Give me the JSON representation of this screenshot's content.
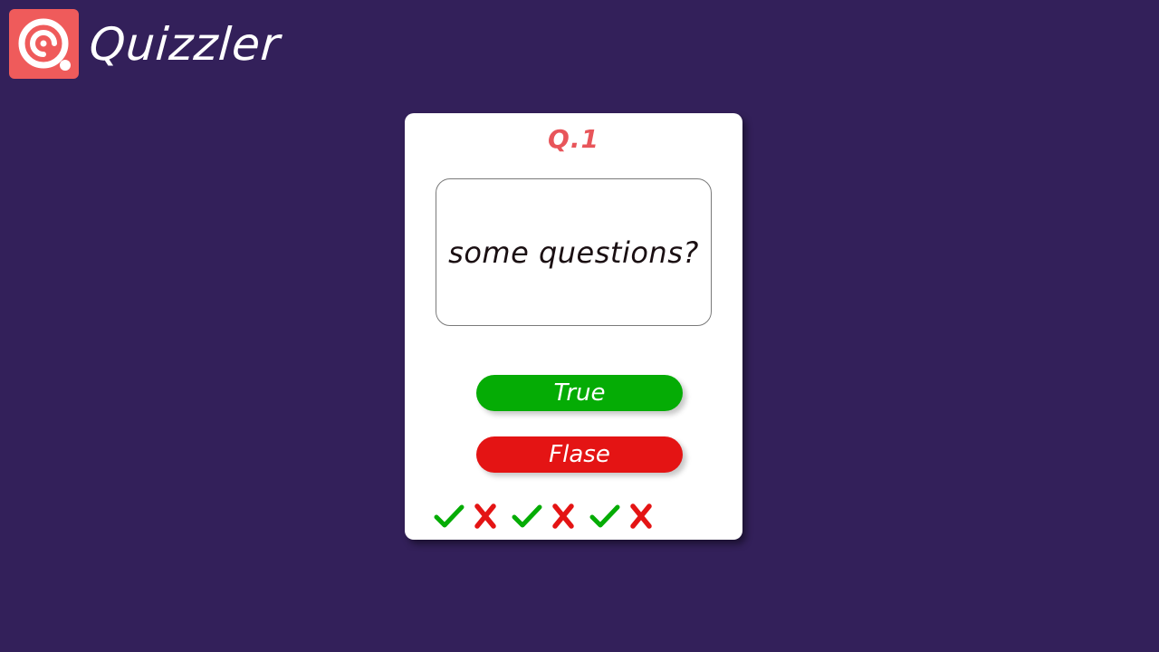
{
  "app": {
    "title": "Quizzler",
    "logo_icon": "quiz-logo-icon",
    "logo_color": "#ef5b5b"
  },
  "colors": {
    "background": "#33205a",
    "card": "#ffffff",
    "accent": "#e8555a",
    "true": "#05ac05",
    "false": "#e41414"
  },
  "quiz": {
    "question_number": "Q.1",
    "question_text": "some questions?",
    "true_label": "True",
    "false_label": "Flase"
  },
  "score": {
    "marks": [
      {
        "result": "correct",
        "icon": "check-icon"
      },
      {
        "result": "wrong",
        "icon": "cross-icon"
      },
      {
        "result": "correct",
        "icon": "check-icon"
      },
      {
        "result": "wrong",
        "icon": "cross-icon"
      },
      {
        "result": "correct",
        "icon": "check-icon"
      },
      {
        "result": "wrong",
        "icon": "cross-icon"
      }
    ]
  }
}
